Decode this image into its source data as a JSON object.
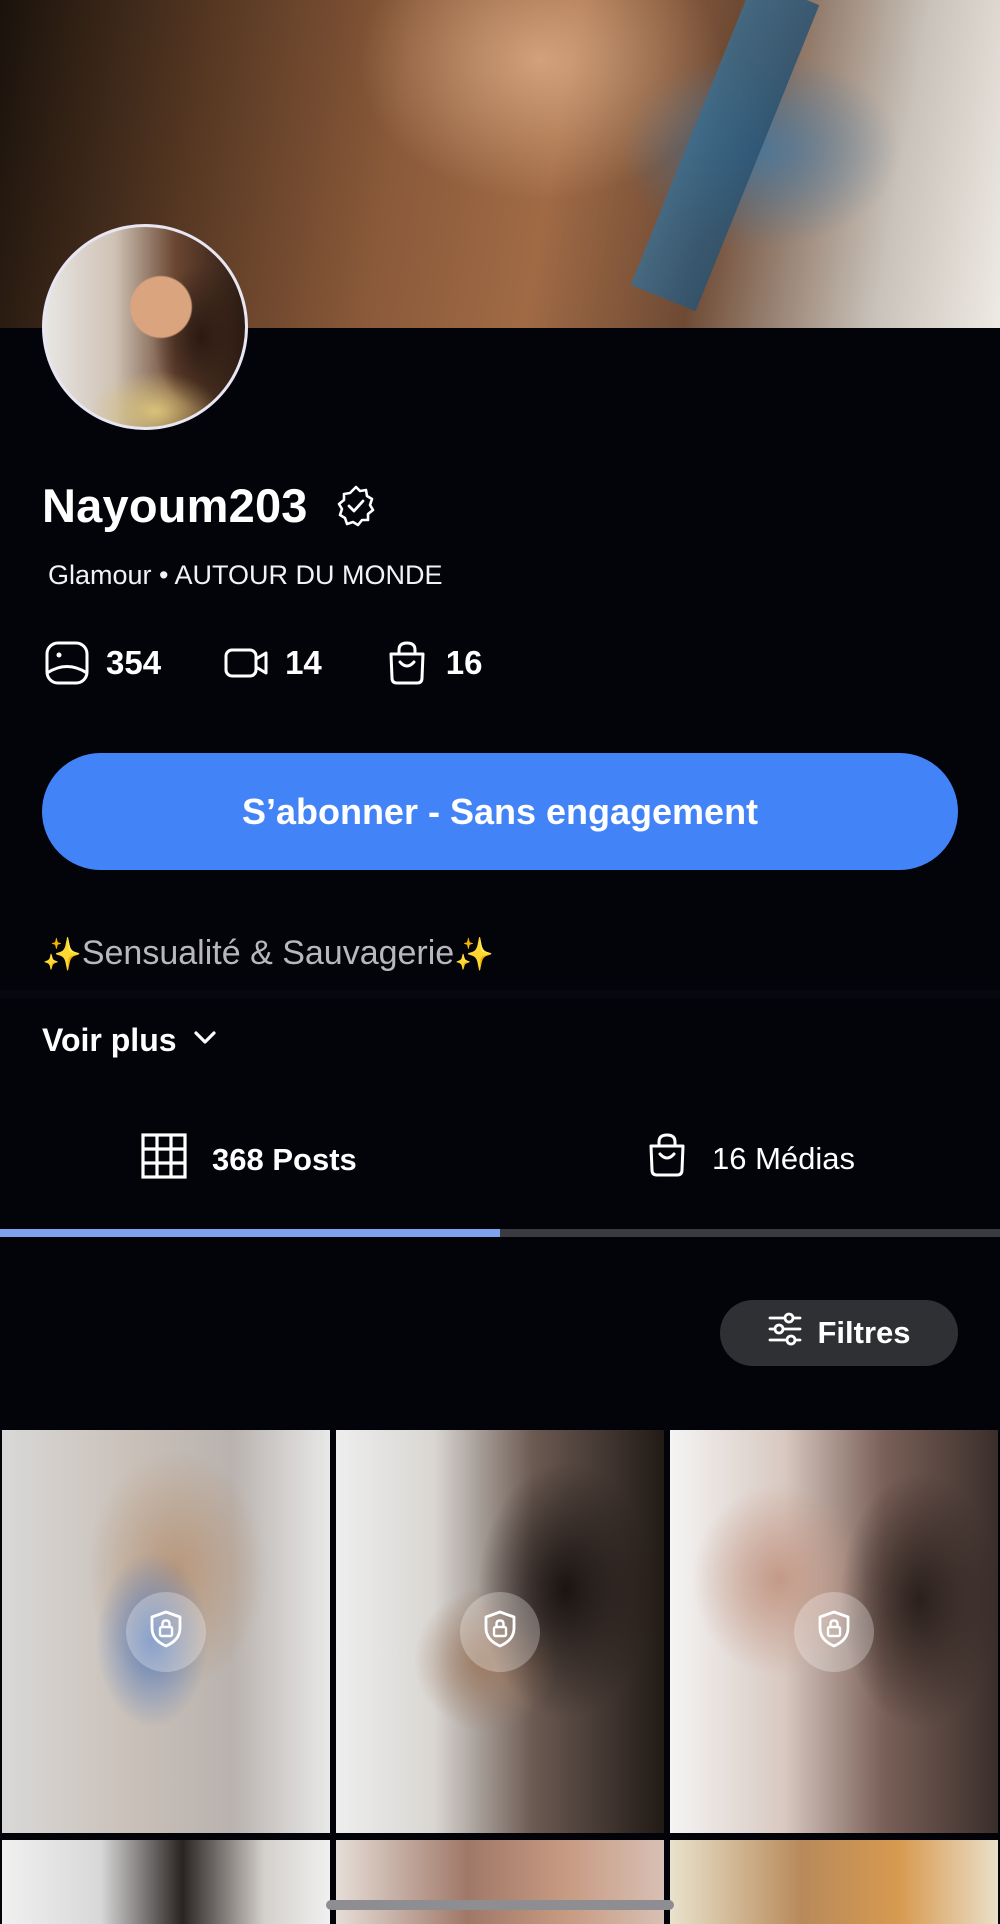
{
  "profile": {
    "username": "Nayoum203",
    "subtitle": "Glamour • AUTOUR DU MONDE",
    "stats": [
      {
        "icon": "photo-icon",
        "value": "354"
      },
      {
        "icon": "video-icon",
        "value": "14"
      },
      {
        "icon": "bag-icon",
        "value": "16"
      }
    ],
    "subscribe_label": "S’abonner - Sans engagement",
    "bio_sparkle_left": "✨",
    "bio_text": "Sensualité & Sauvagerie",
    "bio_sparkle_right": "✨",
    "voir_plus_label": "Voir plus"
  },
  "tabs": [
    {
      "icon": "grid-icon",
      "label": "368 Posts",
      "active": true
    },
    {
      "icon": "bag-icon",
      "label": "16 Médias",
      "active": false
    }
  ],
  "filters_label": "Filtres",
  "grid": {
    "items": [
      {
        "locked": true
      },
      {
        "locked": true
      },
      {
        "locked": true
      },
      {
        "locked": false
      },
      {
        "locked": false
      },
      {
        "locked": false
      }
    ]
  },
  "colors": {
    "background": "#03040a",
    "accent_button": "#4383f8",
    "tab_indicator": "#7ea2f0",
    "filters_bg": "#2f3034",
    "bio_text": "#b7b7bd"
  }
}
